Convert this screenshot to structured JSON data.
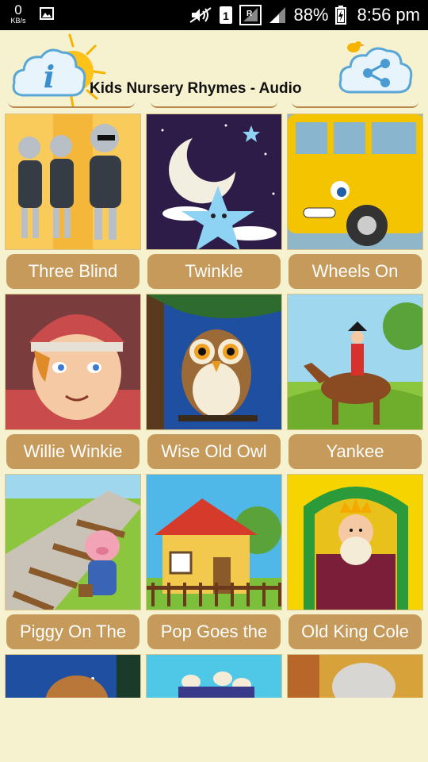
{
  "status": {
    "speed": "0",
    "speed_unit": "KB/s",
    "battery": "88%",
    "time": "8:56 pm",
    "sim": "1"
  },
  "header": {
    "title": "Kids Nursery Rhymes - Audio",
    "info_letter": "i"
  },
  "rhymes": [
    {
      "label": "Three Blind"
    },
    {
      "label": "Twinkle"
    },
    {
      "label": "Wheels On"
    },
    {
      "label": "Willie Winkie"
    },
    {
      "label": "Wise Old Owl"
    },
    {
      "label": "Yankee"
    },
    {
      "label": "Piggy On The"
    },
    {
      "label": "Pop Goes the"
    },
    {
      "label": "Old King Cole"
    }
  ],
  "colors": {
    "label_bg": "#c59a5a",
    "page_bg": "#f6f1cf",
    "status_bg": "#000000"
  }
}
